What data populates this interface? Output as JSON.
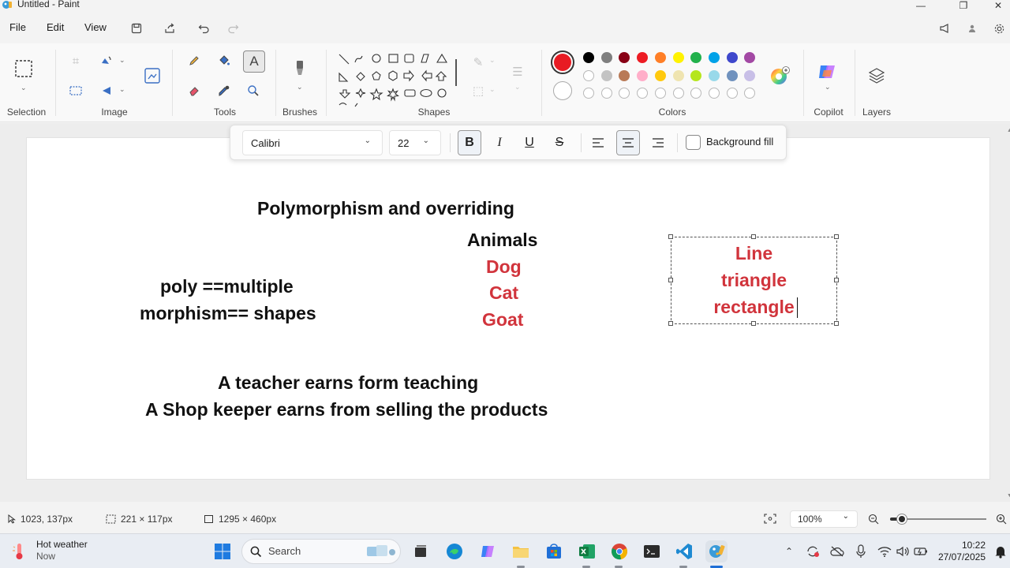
{
  "window": {
    "title": "Untitled - Paint",
    "minimize": "—",
    "maximize": "❐",
    "close": "✕"
  },
  "menu": {
    "file": "File",
    "edit": "Edit",
    "view": "View"
  },
  "ribbon": {
    "groups": {
      "selection": "Selection",
      "image": "Image",
      "tools": "Tools",
      "brushes": "Brushes",
      "shapes": "Shapes",
      "colors": "Colors",
      "copilot": "Copilot",
      "layers": "Layers"
    }
  },
  "colors": {
    "primary": "#e81b23",
    "secondary": "#ffffff",
    "row1": [
      "#000000",
      "#7f7f7f",
      "#880015",
      "#ed1c24",
      "#ff7f27",
      "#fff200",
      "#22b14c",
      "#00a2e8",
      "#3f48cc",
      "#a349a4"
    ],
    "row2": [
      "#ffffff",
      "#c3c3c3",
      "#b97a57",
      "#ffaec9",
      "#ffc90e",
      "#efe4b0",
      "#b5e61d",
      "#99d9ea",
      "#7092be",
      "#c8bfe7"
    ],
    "row3_empty_count": 10
  },
  "text_toolbar": {
    "font_family": "Calibri",
    "font_size": "22",
    "bold": "B",
    "italic": "I",
    "underline": "U",
    "strikethrough": "S",
    "background_fill": "Background fill"
  },
  "canvas": {
    "heading": "Polymorphism  and overriding",
    "left_line1": "poly ==multiple",
    "left_line2": "morphism== shapes",
    "animals_title": "Animals",
    "animals": [
      "Dog",
      "Cat",
      "Goat"
    ],
    "shapes": [
      "Line",
      "triangle",
      "rectangle"
    ],
    "example1": "A teacher earns form teaching",
    "example2": "A Shop keeper earns from selling the products"
  },
  "status": {
    "cursor": "1023, 137px",
    "selection_size": "221 × 117px",
    "canvas_size": "1295 × 460px",
    "zoom": "100%",
    "zoom_slider_fraction": 0.12
  },
  "taskbar": {
    "weather_title": "Hot weather",
    "weather_sub": "Now",
    "search": "Search",
    "time": "10:22",
    "date": "27/07/2025"
  }
}
